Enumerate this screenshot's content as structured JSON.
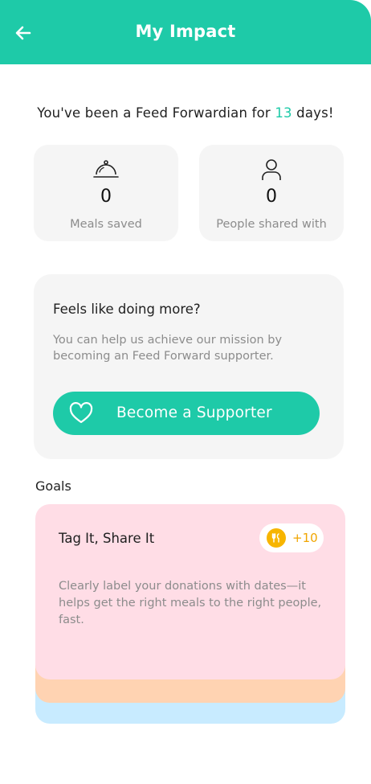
{
  "header": {
    "title": "My Impact",
    "back_icon": "arrow-left-icon"
  },
  "tenure": {
    "prefix": "You've been a Feed Forwardian for ",
    "days": "13",
    "suffix": " days!"
  },
  "stats": {
    "meals": {
      "value": "0",
      "label": "Meals saved",
      "icon": "serving-cloche-icon"
    },
    "people": {
      "value": "0",
      "label": "People shared with",
      "icon": "person-icon"
    }
  },
  "promo": {
    "title": "Feels like doing more?",
    "text": "You can help us achieve our mission by becoming an Feed Forward supporter.",
    "button_label": "Become a Supporter",
    "button_icon": "heart-icon"
  },
  "goals": {
    "heading": "Goals",
    "card": {
      "title": "Tag It, Share It",
      "reward": "+10",
      "reward_icon": "coin-icon",
      "text": "Clearly label your donations with dates—it helps get the right meals to the right people, fast."
    }
  },
  "colors": {
    "accent": "#1ecaa8",
    "card_front": "#ffdde6",
    "card_middle": "#ffd3b2",
    "card_back": "#c8ebff",
    "coin": "#f7b500"
  }
}
